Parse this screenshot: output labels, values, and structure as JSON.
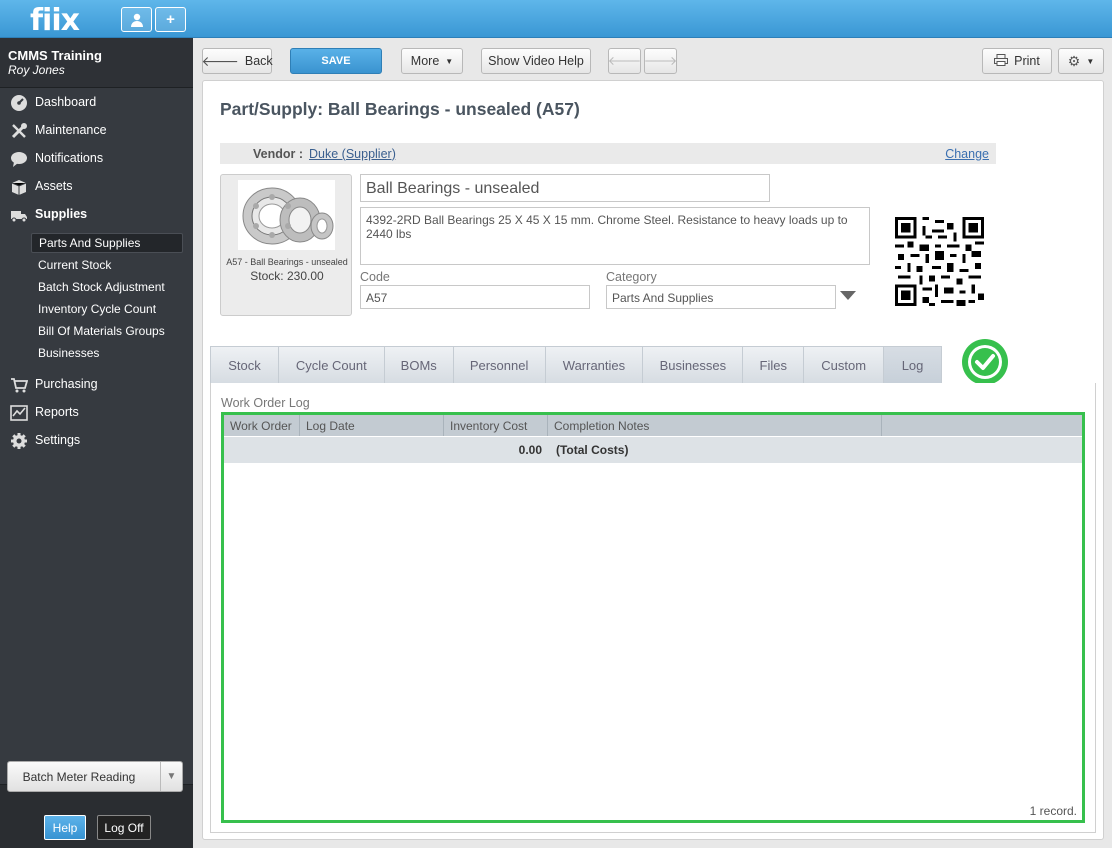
{
  "app": {
    "logo": "fiix"
  },
  "topbar": {
    "user_btn_icon": "user-icon",
    "add_btn_label": "+"
  },
  "sidebar": {
    "company": "CMMS Training",
    "user": "Roy Jones",
    "nav": [
      {
        "label": "Dashboard",
        "icon": "dashboard-icon"
      },
      {
        "label": "Maintenance",
        "icon": "tools-icon"
      },
      {
        "label": "Notifications",
        "icon": "chat-icon"
      },
      {
        "label": "Assets",
        "icon": "box-icon"
      },
      {
        "label": "Supplies",
        "icon": "truck-icon"
      },
      {
        "label": "Purchasing",
        "icon": "cart-icon"
      },
      {
        "label": "Reports",
        "icon": "chart-icon"
      },
      {
        "label": "Settings",
        "icon": "gear-icon"
      }
    ],
    "supplies_sub": [
      "Parts And Supplies",
      "Current Stock",
      "Batch Stock Adjustment",
      "Inventory Cycle Count",
      "Bill Of Materials Groups",
      "Businesses"
    ],
    "batch_label": "Batch Meter Reading",
    "help_label": "Help",
    "logoff_label": "Log Off"
  },
  "toolbar": {
    "back": "Back",
    "save": "SAVE",
    "more": "More",
    "video_help": "Show Video Help",
    "print": "Print"
  },
  "page": {
    "title": "Part/Supply: Ball Bearings - unsealed (A57)",
    "vendor_label": "Vendor :",
    "vendor_value": "Duke (Supplier)",
    "change_label": "Change",
    "image_caption": "A57 - Ball Bearings - unsealed",
    "image_stock": "Stock: 230.00",
    "name": "Ball Bearings - unsealed",
    "description": "4392-2RD Ball Bearings 25 X 45 X 15 mm. Chrome Steel. Resistance to heavy loads up to 2440 lbs",
    "code_label": "Code",
    "code_value": "A57",
    "category_label": "Category",
    "category_value": "Parts And Supplies"
  },
  "tabs": [
    "Stock",
    "Cycle Count",
    "BOMs",
    "Personnel",
    "Warranties",
    "Businesses",
    "Files",
    "Custom",
    "Log"
  ],
  "active_tab": "Log",
  "log": {
    "title": "Work Order Log",
    "columns": [
      "Work Order",
      "Log Date",
      "Inventory Cost",
      "Completion Notes"
    ],
    "total_value": "0.00",
    "total_label": "(Total Costs)",
    "record_count": "1 record."
  },
  "colors": {
    "accent": "#3a97d4",
    "highlight": "#37c04d",
    "sidebar": "#363a40"
  }
}
